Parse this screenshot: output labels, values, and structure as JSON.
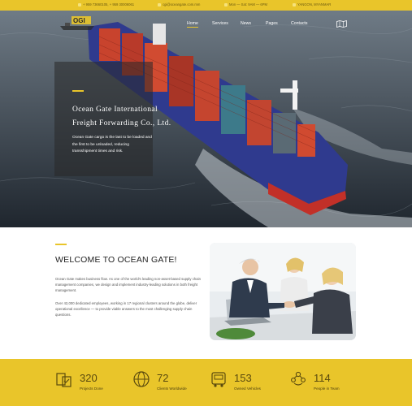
{
  "topbar": {
    "phone": "+ 959 73660105, + 959 30006061",
    "email": "cgi@oceangate.com.mm",
    "hours": "Mon — Sat: 9AM — 6PM",
    "location": "YANGON, MYANMAR"
  },
  "nav": {
    "items": [
      "Home",
      "Services",
      "News",
      "Pages",
      "Contacts"
    ],
    "active": "Home"
  },
  "hero": {
    "title_line1": "Ocean Gate International",
    "title_line2": "Freight Forwarding Co., Ltd.",
    "text": "Ocean Gate cargo is the last to be loaded and the first to be unloaded, reducing transshipment times and risk."
  },
  "welcome": {
    "title": "WELCOME TO OCEAN GATE!",
    "para1": "Ocean Gate makes business flow. As one of the world's leading non-asset-based supply chain management companies, we design and implement industry-leading solutions in both freight management.",
    "para2": "Over 42,000 dedicated employees, working in 17 regional clusters around the globe, deliver operational excellence — to provide viable answers to the most challenging supply chain questions."
  },
  "stats": [
    {
      "value": "320",
      "label": "Projects Done",
      "icon": "projects-icon"
    },
    {
      "value": "72",
      "label": "Clients Worldwide",
      "icon": "globe-icon"
    },
    {
      "value": "153",
      "label": "Owned Vehicles",
      "icon": "truck-icon"
    },
    {
      "value": "114",
      "label": "People in Team",
      "icon": "team-icon"
    }
  ],
  "colors": {
    "accent": "#e9c52a",
    "dark": "#2b343d"
  }
}
